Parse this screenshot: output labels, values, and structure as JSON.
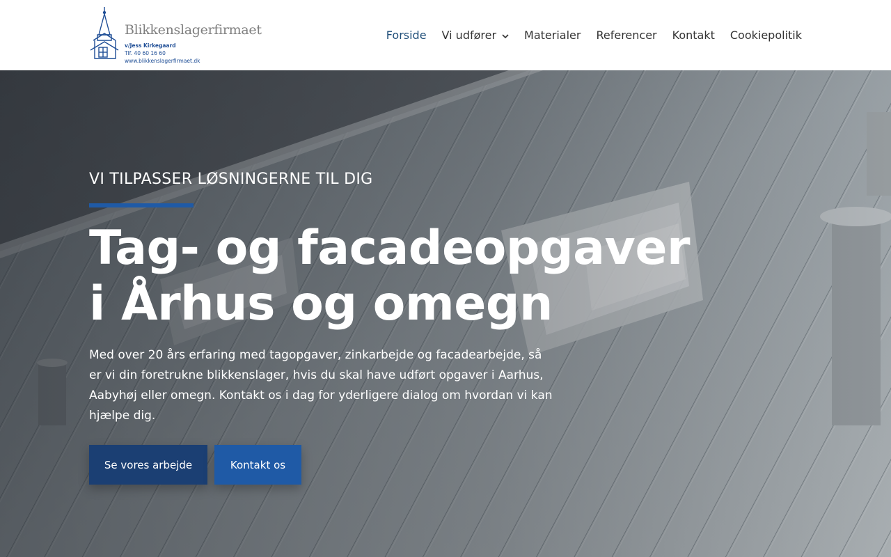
{
  "logo": {
    "name": "Blikkenslagerfirmaet",
    "owner": "v/Jess Kirkegaard",
    "phone": "Tlf. 40 60 16 60",
    "website": "www.blikkenslagerfirmaet.dk"
  },
  "nav": {
    "items": [
      {
        "label": "Forside",
        "active": true
      },
      {
        "label": "Vi udfører",
        "has_dropdown": true
      },
      {
        "label": "Materialer"
      },
      {
        "label": "Referencer"
      },
      {
        "label": "Kontakt"
      },
      {
        "label": "Cookiepolitik"
      }
    ]
  },
  "hero": {
    "kicker": "VI TILPASSER LØSNINGERNE TIL DIG",
    "headline_line1": "Tag- og facadeopgaver",
    "headline_line2": "i Århus og omegn",
    "lead": "Med over 20 års erfaring med tagopgaver, zinkarbejde og facadearbejde, så er vi din foretrukne blikkenslager, hvis du skal have udført opgaver i Aarhus, Aabyhøj eller omegn. Kontakt os i dag for yderligere dialog om hvordan vi kan hjælpe dig.",
    "button_work": "Se vores arbejde",
    "button_contact": "Kontakt os"
  },
  "colors": {
    "brand_blue": "#1f5aa6",
    "brand_dark_blue": "#1b3f73",
    "nav_active": "#1f4e79"
  },
  "icons": {
    "logo": "church-spire-house-icon",
    "dropdown": "chevron-down-icon"
  }
}
